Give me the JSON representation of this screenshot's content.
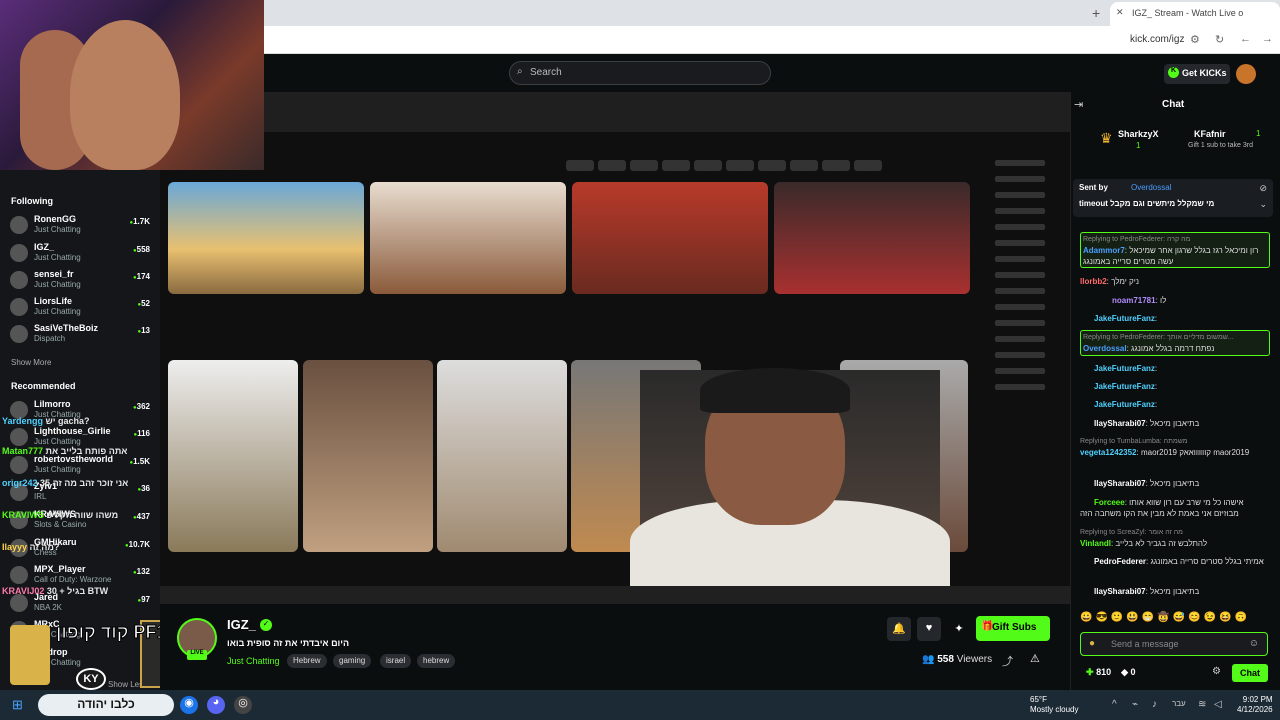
{
  "browser": {
    "tab_title": "IGZ_ Stream - Watch Live o",
    "url": "kick.com/igz",
    "new_tab_icon": "plus-icon",
    "close_icon": "close-icon"
  },
  "header": {
    "search_placeholder": "Search",
    "get_kicks_label": "Get KICKs"
  },
  "sidebar": {
    "following_label": "Following",
    "following": [
      {
        "name": "RonenGG",
        "category": "Just Chatting",
        "viewers": "1.7K"
      },
      {
        "name": "IGZ_",
        "category": "Just Chatting",
        "viewers": "558"
      },
      {
        "name": "sensei_fr",
        "category": "Just Chatting",
        "viewers": "174"
      },
      {
        "name": "LiorsLife",
        "category": "Just Chatting",
        "viewers": "52"
      },
      {
        "name": "SasiVeTheBoiz",
        "category": "Dispatch",
        "viewers": "13"
      }
    ],
    "show_more": "Show More",
    "recommended_label": "Recommended",
    "recommended": [
      {
        "name": "Lilmorro",
        "category": "Just Chatting",
        "viewers": "362"
      },
      {
        "name": "Lighthouse_Girlie",
        "category": "Just Chatting",
        "viewers": "116"
      },
      {
        "name": "robertovstheworld",
        "category": "Just Chatting",
        "viewers": "1.5K"
      },
      {
        "name": "Zylv1",
        "category": "IRL",
        "viewers": "36"
      },
      {
        "name": "KRAVIWS",
        "category": "Slots & Casino",
        "viewers": "437"
      },
      {
        "name": "GMHikaru",
        "category": "Chess",
        "viewers": "10.7K"
      },
      {
        "name": "MPX_Player",
        "category": "Call of Duty: Warzone",
        "viewers": "132"
      },
      {
        "name": "Jared",
        "category": "NBA 2K",
        "viewers": "97"
      },
      {
        "name": "MRxC",
        "category": "Just Chatting",
        "viewers": ""
      },
      {
        "name": "patdrop",
        "category": "Just Chatting",
        "viewers": ""
      }
    ],
    "show_less": "Show Less"
  },
  "overlay_chat": [
    {
      "user": "Yardengg",
      "text": "יש gacha?",
      "color": "#4fd1ff"
    },
    {
      "user": "Matan777",
      "text": "אתה פותח בלייב את",
      "color": "#53fc18"
    },
    {
      "user": "origr242",
      "text": "אני זוכר זהב מה זה 35",
      "color": "#4fd1ff"
    },
    {
      "user": "KRAVIWS",
      "text": "משהו שווה הקליפ",
      "color": "#53fc18"
    },
    {
      "user": "Ilayyy",
      "text": "מה זה?",
      "color": "#ffd54a"
    },
    {
      "user": "KRAVIJ02",
      "text": "30 + בגיל BTW",
      "color": "#ff7aa8"
    }
  ],
  "promo": {
    "headline": "קוד קופון PF17",
    "brand": "KY",
    "taskbar_text": "כלבו יהודה"
  },
  "channel": {
    "name": "IGZ_",
    "live_badge": "LIVE",
    "stream_title": "היום איבדתי את זה סופית בואו",
    "category": "Just Chatting",
    "tags": [
      "Hebrew",
      "gaming",
      "israel",
      "hebrew"
    ],
    "viewers": "558",
    "viewers_label": "Viewers",
    "gift_subs_label": "Gift Subs"
  },
  "chat": {
    "title": "Chat",
    "top_gifter": {
      "user": "SharkzyX",
      "count": "1",
      "user2": "KFafnir",
      "count2": "1",
      "note": "Gift 1 sub to take 3rd"
    },
    "pinned": {
      "sent_by": "Sent by",
      "author": "Overdossal",
      "text": "timeout מי שמקלל מיתשים וגם מקבל"
    },
    "messages": [
      {
        "reply": "Replying to PedroFederer: מה קרה",
        "user": "Adammor7",
        "text": "רון ומיכאל רגז בגלל שרגון אחר שמיכאל עשה מטרים סרייה באמונגג",
        "color": "#4a9eff",
        "hl": true
      },
      {
        "reply": "",
        "user": "llorbb2",
        "text": "ניק ימלך",
        "color": "#ff6a6a",
        "hl": false
      },
      {
        "reply": "",
        "user": "noam71781",
        "text": "לו",
        "color": "#b38cff",
        "hl": false
      },
      {
        "reply": "",
        "user": "JakeFutureFanz",
        "text": "",
        "color": "#4fd1ff",
        "hl": false
      },
      {
        "reply": "Replying to PedroFederer: שמשום מדליים אותך...",
        "user": "Overdossal",
        "text": "נפתח דרמה בגלל אמונגג",
        "color": "#4a9eff",
        "hl": true
      },
      {
        "reply": "",
        "user": "JakeFutureFanz",
        "text": "",
        "color": "#4fd1ff",
        "hl": false
      },
      {
        "reply": "",
        "user": "JakeFutureFanz",
        "text": "",
        "color": "#4fd1ff",
        "hl": false
      },
      {
        "reply": "",
        "user": "JakeFutureFanz",
        "text": "",
        "color": "#4fd1ff",
        "hl": false
      },
      {
        "reply": "",
        "user": "IlaySharabi07",
        "text": "בתיאבון מיכאל",
        "color": "#ffffff",
        "hl": false
      },
      {
        "reply": "Replying to TumbaLumba: משמתה",
        "user": "vegeta1242352",
        "text": "maor2019 קוווווואאק maor2019",
        "color": "#4fd1ff",
        "hl": false
      },
      {
        "reply": "",
        "user": "IlaySharabi07",
        "text": "בתיאבון מיכאל",
        "color": "#ffffff",
        "hl": false
      },
      {
        "reply": "",
        "user": "Forceee",
        "text": "אישהו כל מי שרב עם רון שווא אותו מבוזיזם אני באמת לא מבין את הקו משחבה הזה",
        "color": "#53fc18",
        "hl": false
      },
      {
        "reply": "Replying to ScreaZyl: מה זה אומר",
        "user": "Vinlandl",
        "text": "להתלבש זה בגביר לא בלייב",
        "color": "#53fc18",
        "hl": false
      },
      {
        "reply": "",
        "user": "PedroFederer",
        "text": "אמיתי בגלל סטרים סרייה באמונגג",
        "color": "#ffffff",
        "hl": false
      },
      {
        "reply": "",
        "user": "IlaySharabi07",
        "text": "בתיאבון מיכאל",
        "color": "#ffffff",
        "hl": false
      }
    ],
    "input_placeholder": "Send a message",
    "points": "810",
    "points2": "0",
    "chat_button": "Chat"
  },
  "taskbar": {
    "weather_temp": "65°F",
    "weather_desc": "Mostly cloudy",
    "lang": "עבר",
    "time": "9:02 PM",
    "date": "4/12/2026"
  },
  "colors": {
    "accent": "#53fc18",
    "bg": "#0b0e0f"
  }
}
